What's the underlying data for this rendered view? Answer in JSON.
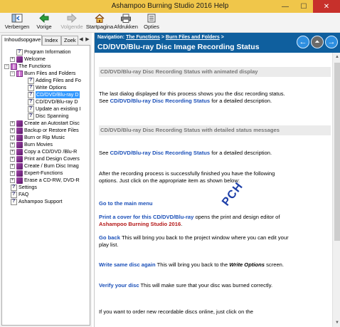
{
  "window": {
    "title": "Ashampoo Burning Studio 2016 Help",
    "min": "—",
    "max": "☐",
    "close": "✕"
  },
  "toolbar": {
    "hide": "Verbergen",
    "back": "Vorige",
    "forward": "Volgende",
    "home": "Startpagina",
    "print": "Afdrukken",
    "options": "Opties"
  },
  "tabs": {
    "contents": "Inhoudsopgave",
    "index": "Index",
    "search": "Zoek"
  },
  "tree": [
    {
      "label": "Program Information",
      "icon": "help-page",
      "level": 1
    },
    {
      "label": "Welcome",
      "icon": "book",
      "level": 1,
      "expander": "+"
    },
    {
      "label": "The Functions",
      "icon": "book-open",
      "level": 0,
      "expander": "−"
    },
    {
      "label": "Burn Files and Folders",
      "icon": "book-open",
      "level": 1,
      "expander": "−"
    },
    {
      "label": "Adding Files and Fo",
      "icon": "help-page",
      "level": 2
    },
    {
      "label": "Write Options",
      "icon": "help-page",
      "level": 2
    },
    {
      "label": "CD/DVD/Blu-ray D",
      "icon": "help-page",
      "level": 2,
      "selected": true
    },
    {
      "label": "CD/DVD/Blu-ray D",
      "icon": "help-page",
      "level": 2
    },
    {
      "label": "Update an existing I",
      "icon": "help-page",
      "level": 2
    },
    {
      "label": "Disc Spanning",
      "icon": "help-page",
      "level": 2
    },
    {
      "label": "Create an Autostart Disc",
      "icon": "book",
      "level": 1,
      "expander": "+"
    },
    {
      "label": "Backup or Restore Files",
      "icon": "book",
      "level": 1,
      "expander": "+"
    },
    {
      "label": "Burn or Rip Music",
      "icon": "book",
      "level": 1,
      "expander": "+"
    },
    {
      "label": "Burn Movies",
      "icon": "book",
      "level": 1,
      "expander": "+"
    },
    {
      "label": "Copy a CD/DVD /Blu-R",
      "icon": "book",
      "level": 1,
      "expander": "+"
    },
    {
      "label": "Print and Design Covers",
      "icon": "book",
      "level": 1,
      "expander": "+"
    },
    {
      "label": "Create / Burn Disc Imag",
      "icon": "book",
      "level": 1,
      "expander": "+"
    },
    {
      "label": "Expert-Functions",
      "icon": "book",
      "level": 1,
      "expander": "+"
    },
    {
      "label": "Erase a CD-RW, DVD-R",
      "icon": "book",
      "level": 1,
      "expander": "+"
    },
    {
      "label": "Settings",
      "icon": "help-page",
      "level": 0
    },
    {
      "label": "FAQ",
      "icon": "help-page",
      "level": 0
    },
    {
      "label": "Ashampoo Support",
      "icon": "help-page",
      "level": 0
    }
  ],
  "header": {
    "nav_label": "Navigation:",
    "crumb1": "The Functions",
    "sep": ">",
    "crumb2": "Burn Files and Folders",
    "crumb_tail": ">",
    "title": "CD/DVD/Blu-ray Disc Image Recording Status"
  },
  "content": {
    "section1": "CD/DVD/Blu-ray Disc Recording Status with animated display",
    "p1_a": "The last dialog displayed for this process shows you the disc recording status. See ",
    "p1_link": "CD/DVD/Blu-ray Disc Recording Status",
    "p1_b": " for a detailed description.",
    "section2": "CD/DVD/Blu-ray Disc Recording Status with detailed status messages",
    "p2_a": "See ",
    "p2_link": "CD/DVD/Blu-ray Disc Recording Status",
    "p2_b": "  for a detailed description.",
    "p3": "After the recording process is successfully finished you have the following options. Just click on the appropriate item as shown below:",
    "o1": "Go to the main menu",
    "o2_link": "Print a cover for this CD/DVD/Blu-ray",
    "o2_a": " opens the print and design editor of ",
    "o2_brand": "Ashampoo Burning Studio 2016",
    "o2_b": ".",
    "o3_link": "Go back",
    "o3_a": " This will bring you back to the project window where you can edit your play list.",
    "o4_link": "Write same disc again",
    "o4_a": " This will bring you back to the ",
    "o4_em": "Write Options",
    "o4_b": " screen.",
    "o5_link": "Verify your disc",
    "o5_a": " This will make sure that your disc was burned correctly.",
    "p_last": "If you want to order new recordable discs online, just click on the"
  },
  "watermark": "PCH",
  "colors": {
    "titlebar": "#f0c64a",
    "header": "#0f5f9e",
    "link": "#1a4fb8",
    "brand": "#b51a1a",
    "selected": "#3399ff"
  }
}
